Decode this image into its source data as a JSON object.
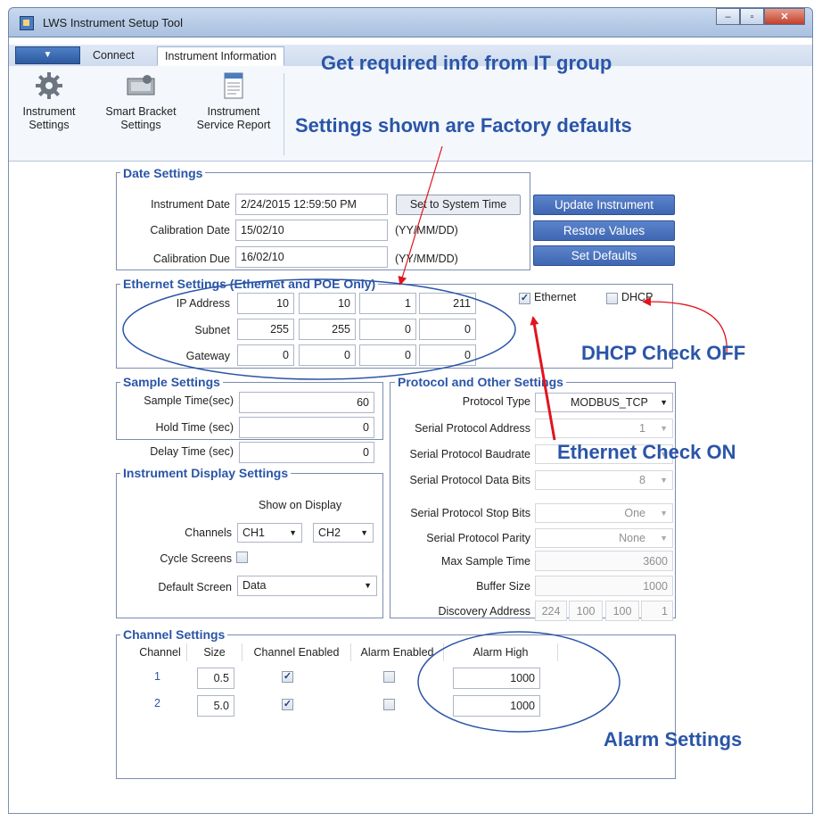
{
  "window": {
    "title": "LWS Instrument Setup Tool",
    "minimize": "–",
    "maximize": "▫",
    "close": "✕"
  },
  "ribbon": {
    "menu_glyph": "▼",
    "tabs": [
      {
        "label": "Connect"
      },
      {
        "label": "Instrument Information"
      }
    ],
    "buttons": [
      {
        "line1": "Instrument",
        "line2": "Settings",
        "icon": "gear-icon"
      },
      {
        "line1": "Smart Bracket",
        "line2": "Settings",
        "icon": "bracket-icon"
      },
      {
        "line1": "Instrument",
        "line2": "Service Report",
        "icon": "report-icon"
      }
    ]
  },
  "callouts": {
    "it_group": "Get required info from IT group",
    "factory_defaults": "Settings shown are Factory defaults",
    "dhcp_off": "DHCP Check OFF",
    "ethernet_on": "Ethernet Check ON",
    "alarm": "Alarm Settings"
  },
  "date_settings": {
    "title": "Date Settings",
    "instrument_date_label": "Instrument Date",
    "instrument_date_value": "2/24/2015 12:59:50 PM",
    "set_system_time": "Set to System Time",
    "calibration_date_label": "Calibration Date",
    "calibration_date_value": "15/02/10",
    "calibration_date_hint": "(YY/MM/DD)",
    "calibration_due_label": "Calibration Due",
    "calibration_due_value": "16/02/10",
    "calibration_due_hint": "(YY/MM/DD)"
  },
  "actions": {
    "update": "Update Instrument",
    "restore": "Restore Values",
    "defaults": "Set Defaults"
  },
  "ethernet": {
    "title": "Ethernet Settings (Ethernet and POE Only)",
    "ip_label": "IP Address",
    "ip": [
      "10",
      "10",
      "1",
      "211"
    ],
    "subnet_label": "Subnet",
    "subnet": [
      "255",
      "255",
      "0",
      "0"
    ],
    "gateway_label": "Gateway",
    "gateway": [
      "0",
      "0",
      "0",
      "0"
    ],
    "ethernet_label": "Ethernet",
    "ethernet_checked": "✓",
    "dhcp_label": "DHCP",
    "dhcp_checked": ""
  },
  "sample": {
    "title": "Sample Settings",
    "sample_time_label": "Sample Time(sec)",
    "sample_time": "60",
    "hold_time_label": "Hold Time (sec)",
    "hold_time": "0",
    "delay_time_label": "Delay Time (sec)",
    "delay_time": "0"
  },
  "display": {
    "title": "Instrument Display Settings",
    "show_on_display": "Show on Display",
    "channels_label": "Channels",
    "channel_a": "CH1",
    "channel_b": "CH2",
    "cycle_label": "Cycle Screens",
    "cycle_checked": "",
    "default_screen_label": "Default Screen",
    "default_screen": "Data"
  },
  "protocol": {
    "title": "Protocol and Other Settings",
    "protocol_type_label": "Protocol Type",
    "protocol_type": "MODBUS_TCP",
    "serial_address_label": "Serial Protocol Address",
    "serial_address": "1",
    "serial_baud_label": "Serial Protocol Baudrate",
    "serial_baud": "",
    "data_bits_label": "Serial Protocol Data Bits",
    "data_bits": "8",
    "stop_bits_label": "Serial Protocol Stop Bits",
    "stop_bits": "One",
    "parity_label": "Serial Protocol Parity",
    "parity": "None",
    "max_sample_label": "Max Sample Time",
    "max_sample": "3600",
    "buffer_label": "Buffer Size",
    "buffer": "1000",
    "discovery_label": "Discovery Address",
    "discovery": [
      "224",
      "100",
      "100",
      "1"
    ]
  },
  "channels": {
    "title": "Channel Settings",
    "headers": {
      "channel": "Channel",
      "size": "Size",
      "enabled": "Channel Enabled",
      "alarm_enabled": "Alarm Enabled",
      "alarm_high": "Alarm High"
    },
    "rows": [
      {
        "channel": "1",
        "size": "0.5",
        "enabled": "✓",
        "alarm": "",
        "alarm_high": "1000"
      },
      {
        "channel": "2",
        "size": "5.0",
        "enabled": "✓",
        "alarm": "",
        "alarm_high": "1000"
      }
    ]
  },
  "colors": {
    "accent": "#2a55a8",
    "arrow": "#e0141e",
    "button": "#4a72bd"
  }
}
